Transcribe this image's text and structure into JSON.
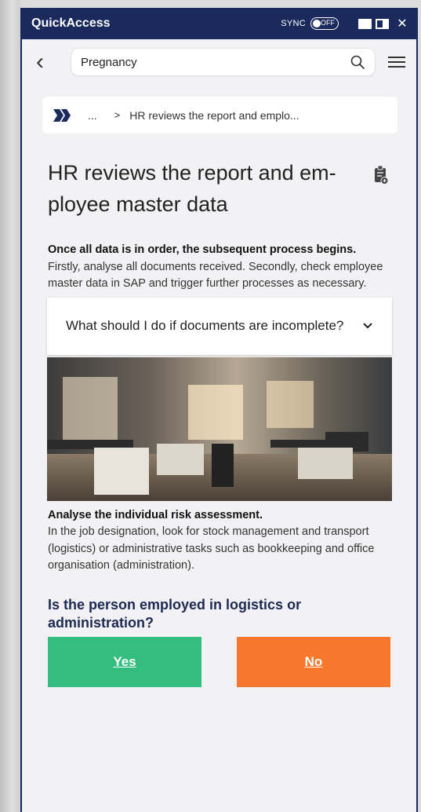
{
  "titlebar": {
    "app_title": "QuickAccess",
    "sync_label": "SYNC",
    "sync_state": "OFF"
  },
  "search": {
    "value": "Pregnancy"
  },
  "breadcrumb": {
    "ellipsis": "...",
    "separator": ">",
    "current": "HR reviews the report and emplo..."
  },
  "page": {
    "title": "HR reviews the report and em-ployee master data",
    "intro_bold": "Once all data is in order, the subsequent process begins.",
    "intro_text": "Firstly, analyse all documents received. Secondly, check employee master data in SAP and trigger further processes as necessary.",
    "faq_label": "What should I do if documents are incomplete?",
    "risk_bold": "Analyse the individual risk assessment.",
    "risk_text": "In the job designation, look for stock management and transport (logistics) or administrative tasks such as bookkeeping and office organisation (administration).",
    "question": "Is the person employed in logistics or administration?",
    "yes_label": "Yes",
    "no_label": "No"
  },
  "colors": {
    "titlebar": "#1b2a5c",
    "yes": "#33bd7f",
    "no": "#f7772d",
    "question": "#1c2a52"
  },
  "icons": [
    "back-arrow-icon",
    "search-icon",
    "menu-icon",
    "double-chevron-icon",
    "clipboard-add-icon",
    "chevron-down-icon",
    "close-icon"
  ]
}
